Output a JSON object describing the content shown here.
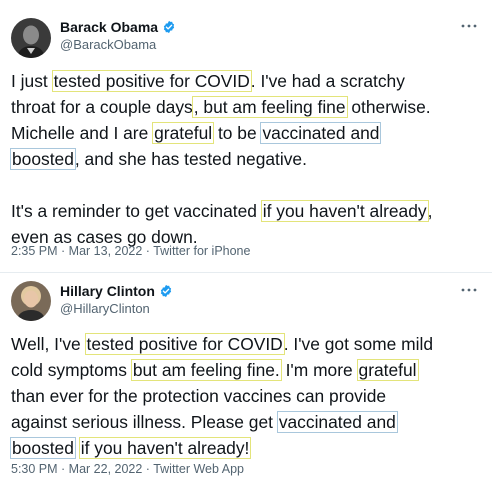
{
  "tweets": [
    {
      "name": "Barack Obama",
      "handle": "@BarackObama",
      "more_icon": "more-horizontal-icon",
      "verified_color": "#1d9bf0",
      "lines": [
        {
          "segments": [
            {
              "t": "I just ",
              "h": ""
            },
            {
              "t": "tested positive for COVID",
              "h": "y"
            },
            {
              "t": ". I've had a scratchy",
              "h": ""
            }
          ]
        },
        {
          "segments": [
            {
              "t": "throat for a couple days",
              "h": ""
            },
            {
              "t": ", but am feeling fine",
              "h": "y"
            },
            {
              "t": " otherwise.",
              "h": ""
            }
          ]
        },
        {
          "segments": [
            {
              "t": "Michelle and I are ",
              "h": ""
            },
            {
              "t": "grateful",
              "h": "y"
            },
            {
              "t": " to be ",
              "h": ""
            },
            {
              "t": "vaccinated and",
              "h": "b"
            }
          ]
        },
        {
          "segments": [
            {
              "t": "boosted",
              "h": "b"
            },
            {
              "t": ", and she has tested negative.",
              "h": ""
            }
          ]
        },
        {
          "segments": []
        },
        {
          "segments": [
            {
              "t": "It's a reminder to get vaccinated ",
              "h": ""
            },
            {
              "t": "if you haven't already",
              "h": "y"
            },
            {
              "t": ",",
              "h": ""
            }
          ]
        },
        {
          "segments": [
            {
              "t": "even as cases go down.",
              "h": ""
            }
          ]
        }
      ],
      "meta": "2:35 PM · Mar 13, 2022 · Twitter for iPhone"
    },
    {
      "name": "Hillary Clinton",
      "handle": "@HillaryClinton",
      "more_icon": "more-horizontal-icon",
      "verified_color": "#1d9bf0",
      "lines": [
        {
          "segments": [
            {
              "t": "Well, I've ",
              "h": ""
            },
            {
              "t": "tested positive for COVID",
              "h": "y"
            },
            {
              "t": ". I've got some mild",
              "h": ""
            }
          ]
        },
        {
          "segments": [
            {
              "t": "cold symptoms ",
              "h": ""
            },
            {
              "t": "but am feeling fine.",
              "h": "y"
            },
            {
              "t": " I'm more ",
              "h": ""
            },
            {
              "t": "grateful",
              "h": "y"
            }
          ]
        },
        {
          "segments": [
            {
              "t": "than ever for the protection vaccines can provide",
              "h": ""
            }
          ]
        },
        {
          "segments": [
            {
              "t": "against serious illness. Please get ",
              "h": ""
            },
            {
              "t": "vaccinated and",
              "h": "b"
            }
          ]
        },
        {
          "segments": [
            {
              "t": "boosted",
              "h": "b"
            },
            {
              "t": " ",
              "h": ""
            },
            {
              "t": "if you haven't already!",
              "h": "y"
            }
          ]
        }
      ],
      "meta": "5:30 PM · Mar 22, 2022 · Twitter Web App"
    }
  ]
}
